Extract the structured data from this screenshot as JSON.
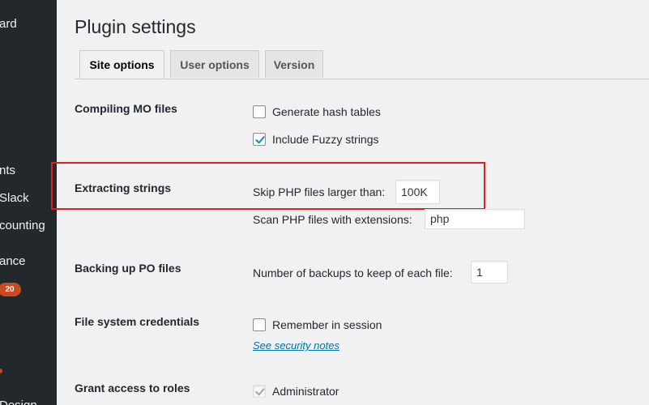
{
  "sidebar": {
    "items": [
      {
        "label": "ard"
      },
      {
        "label": "nts"
      },
      {
        "label": "Slack"
      },
      {
        "label": "counting"
      },
      {
        "label": "ance"
      },
      {
        "label": "Design"
      }
    ],
    "badge": "20"
  },
  "page": {
    "title": "Plugin settings"
  },
  "tabs": [
    {
      "label": "Site options",
      "active": true
    },
    {
      "label": "User options",
      "active": false
    },
    {
      "label": "Version",
      "active": false
    }
  ],
  "sections": {
    "compiling": {
      "label": "Compiling MO files",
      "options": [
        {
          "label": "Generate hash tables",
          "checked": false
        },
        {
          "label": "Include Fuzzy strings",
          "checked": true
        }
      ]
    },
    "extracting": {
      "label": "Extracting strings",
      "skip_label": "Skip PHP files larger than:",
      "skip_value": "100K",
      "scan_label": "Scan PHP files with extensions:",
      "scan_value": "php"
    },
    "backing": {
      "label": "Backing up PO files",
      "backups_label": "Number of backups to keep of each file:",
      "backups_value": "1"
    },
    "filesystem": {
      "label": "File system credentials",
      "remember_label": "Remember in session",
      "remember_checked": false,
      "security_link": "See security notes"
    },
    "roles": {
      "label": "Grant access to roles",
      "admin_label": "Administrator",
      "admin_checked": true
    }
  },
  "colors": {
    "sidebar_bg": "#23282d",
    "badge": "#ca4a1f",
    "highlight": "#e01e1e",
    "link": "#0073aa"
  }
}
